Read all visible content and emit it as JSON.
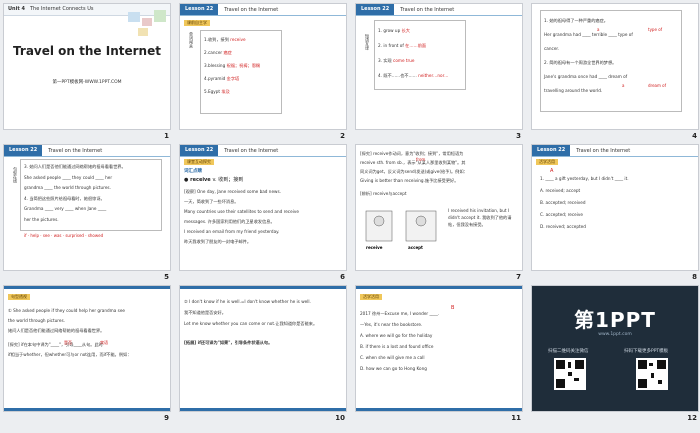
{
  "s1": {
    "unit": "Unit 4",
    "unit_title": "The Internet Connects Us",
    "title": "Travel on the Internet",
    "footer": "第一PPT模板网-WWW.1PPT.COM",
    "num": "1"
  },
  "s2": {
    "lesson": "Lesson 22",
    "title": "Travel on the Internet",
    "tag": "课前自主学",
    "side": "单词闯关",
    "items": [
      "1.收到，接到",
      "2.cancer",
      "3.blessing",
      "4.pyramid",
      "5.Egypt"
    ],
    "answers": [
      "receive",
      "癌症",
      "祝福；祝祷；恩赐",
      "金字塔",
      "埃及"
    ],
    "num": "2"
  },
  "s3": {
    "lesson": "Lesson 22",
    "title": "Travel on the Internet",
    "side": "短语互译",
    "items": [
      "1. grow up",
      "2. in front of",
      "3. 实现",
      "4. 既不……也不……"
    ],
    "answers": [
      "长大",
      "在……前面",
      "come true",
      "neither…nor…"
    ],
    "num": "3"
  },
  "s4": {
    "lines": [
      "1. 她的祖母得了一种严重的癌症。",
      "Her grandma had ____ terrible ____ type of",
      "cancer.",
      "2. 简的祖母有一个周游全世界的梦想。",
      "Jane's grandma once had ____ dream of",
      "travelling around the world."
    ],
    "answers": [
      "a",
      "type of",
      "a",
      "dream of"
    ],
    "num": "4"
  },
  "s5": {
    "lesson": "Lesson 22",
    "title": "Travel on the Internet",
    "side": "句型在线",
    "lines": [
      "3. 她问人们是否他们能通过网络帮她的祖母看看世界。",
      "She asked people ____ they could ____ her",
      "grandma ____ the world through pictures.",
      "4. 当简把这些照片给祖母看时，她很惊讶。",
      "Grandma ____ very ____ when Jane ____",
      "her the pictures."
    ],
    "answers": [
      "if",
      "help",
      "see",
      "was",
      "surprised",
      "showed"
    ],
    "num": "5"
  },
  "s6": {
    "lesson": "Lesson 22",
    "title": "Travel on the Internet",
    "tag": "课堂互动探究",
    "heading": "词汇点睛",
    "keyword": "receive",
    "keyword_def": "v. 收到；接到",
    "lines": [
      "[观察] One day, Jane received some bad news.",
      "一天，简收到了一些坏消息。",
      "Many countries use their satellites to send and receive",
      "messages. 许多国家利用他们的卫星收发信息。",
      "I received an email from my friend yesterday.",
      "昨天我收到了朋友的一封电子邮件。"
    ],
    "num": "6"
  },
  "s7": {
    "lines": [
      "[探究] receive作动词，意为\"收到；接到\"，常用短语为",
      "receive sth. from sb.，表示\"从某人那里收到某物\"。其",
      "同义词为get，反义词为send(发送)或give(给予)。例如：",
      "Giving is better than receiving.施予比接受更好。",
      "[辨析] receive与accept"
    ],
    "note": "I received his invitation, but I didn't accept it. 我收到了他的请帖，但我没有接受。",
    "labels": [
      "receive",
      "accept"
    ],
    "answer": "from",
    "num": "7"
  },
  "s8": {
    "lesson": "Lesson 22",
    "title": "Travel on the Internet",
    "tag": "活学活用",
    "q": "1. ____ a gift yesterday, but I didn't ____ it.",
    "opts": [
      "A. received; accept",
      "B. accepted; received",
      "C. accepted; receive",
      "D. received; accepted"
    ],
    "answer": "A",
    "num": "8"
  },
  "s9": {
    "tag": "句型透视",
    "lines": [
      "① She asked people if they could help her grandma see",
      "the world through pictures.",
      "她问人们是否他们能通过网络帮她的祖母看看世界。",
      "[探究] if在本句中译为\"____\"，引导____从句。此时",
      "if相当于whether，但whether可与or not连用，而if不能。例如："
    ],
    "answers": [
      "是否",
      "宾语"
    ],
    "num": "9"
  },
  "s10": {
    "lines": [
      "② I don't know if he is well.=I don't know whether he is well.",
      "我不知道他是否安好。",
      "Let me know whether you can come or not.让我知道你是否能来。",
      "[拓展] if还可译为\"如果\"，引导条件状语从句。"
    ],
    "num": "10"
  },
  "s11": {
    "tag": "活学活用",
    "q": "2017 徐州—Excuse me, I wonder ____.",
    "q2": "—Yes, it's near the bookstore.",
    "opts": [
      "A. where we will go for the holiday",
      "B. if there is a lost and found office",
      "C. when she will give me a call",
      "D. how we can go to Hong Kong"
    ],
    "answer": "B",
    "num": "11"
  },
  "s12": {
    "logo": "第1PPT",
    "logo_sub": "www.1ppt.com",
    "left_caption": "扫描二维码关注微信",
    "right_caption": "扫码下载更多PPT模板",
    "num": "12"
  },
  "colors": {
    "accent": "#2f6ea8",
    "answer": "#d01b1b",
    "highlight": "#f0c75a"
  }
}
